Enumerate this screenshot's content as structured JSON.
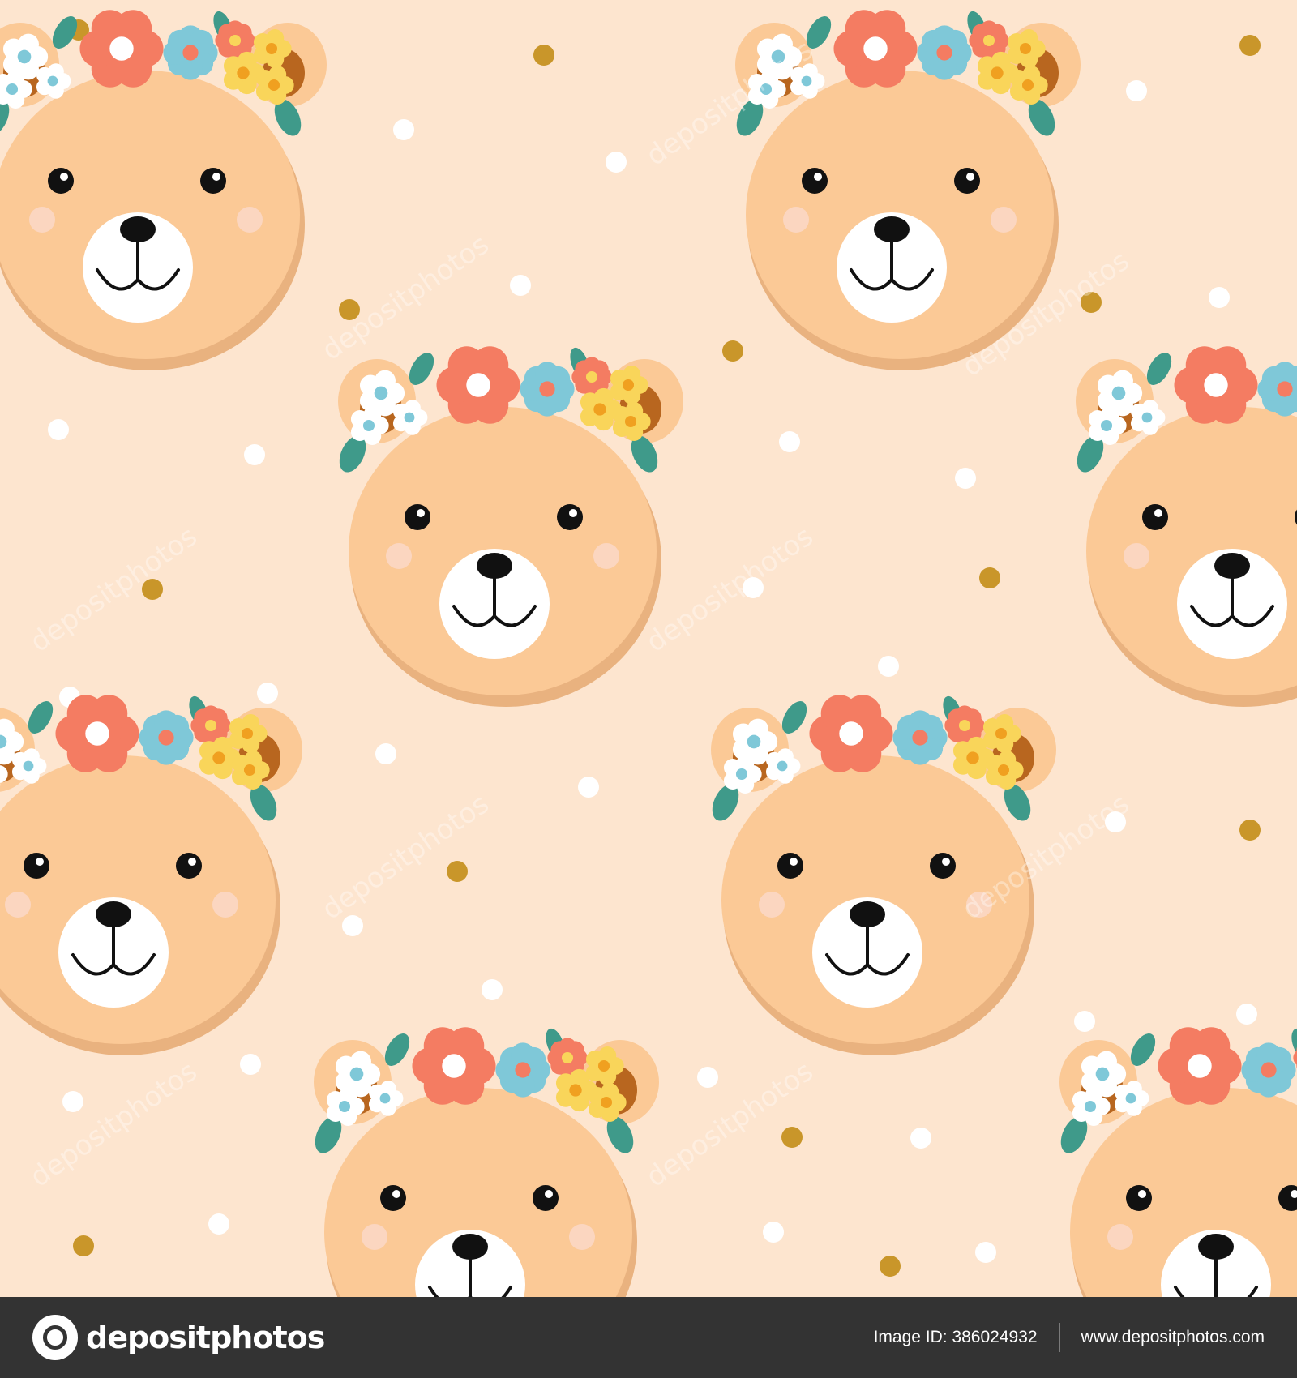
{
  "illustration": {
    "subject": "bear-faces-with-flower-crowns",
    "colors": {
      "background": "#fde5cf",
      "face": "#fbc996",
      "face_shadow": "#e9b27f",
      "ear_inner": "#b8661f",
      "muzzle": "#ffffff",
      "cheek": "#fbd6c0",
      "eye": "#111111",
      "flower_coral": "#f47c62",
      "flower_blue": "#7fc8d8",
      "flower_yellow": "#f9d55a",
      "leaf": "#3f9a8a",
      "dot_white": "#ffffff",
      "dot_gold": "#c9962a"
    }
  },
  "watermark_text": "depositphotos",
  "footer": {
    "brand": "depositphotos",
    "image_id": "Image ID: 386024932",
    "site": "www.depositphotos.com"
  }
}
